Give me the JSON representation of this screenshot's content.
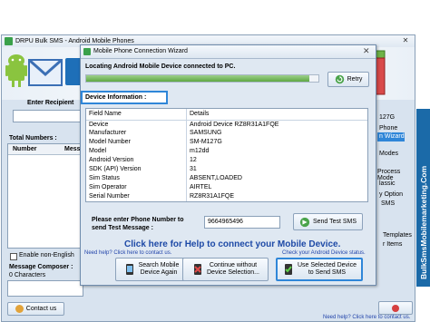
{
  "main_window": {
    "title": "DRPU Bulk SMS - Android Mobile Phones",
    "left_labels": {
      "enter_recipient": "Enter Recipient",
      "total_numbers": "Total Numbers :",
      "number_col": "Number",
      "message_col": "Mess",
      "enable_non_english": "Enable non-English",
      "message_composer": "Message Composer :",
      "char_count": "0 Characters"
    },
    "right_items": [
      "127G",
      "Phone",
      "n Wizard",
      "Modes",
      "Process Mode",
      "lassic",
      "y Option",
      "SMS",
      "Templates",
      "r Items"
    ],
    "contact_us": "Contact us",
    "need_help": "Need help? Click here to contact us.",
    "close_icon": "close-icon"
  },
  "dialog": {
    "title": "Mobile Phone Connection Wizard",
    "locating": "Locating Android Mobile Device connected to PC.",
    "progress_fraction": 0.96,
    "retry": "Retry",
    "device_info_tab": "Device Information :",
    "table": {
      "headers": [
        "Field Name",
        "Details"
      ],
      "rows": [
        [
          "Device",
          "Android Device RZ8R31A1FQE"
        ],
        [
          "Manufacturer",
          "SAMSUNG"
        ],
        [
          "Model Number",
          "SM-M127G"
        ],
        [
          "Model",
          "m12dd"
        ],
        [
          "Android Version",
          "12"
        ],
        [
          "SDK (API) Version",
          "31"
        ],
        [
          "Sim Status",
          "ABSENT,LOADED"
        ],
        [
          "Sim Operator",
          "AIRTEL"
        ],
        [
          "Serial Number",
          "RZ8R31A1FQE"
        ]
      ]
    },
    "phone_prompt_line1": "Please enter Phone Number to",
    "phone_prompt_line2": "send Test Message :",
    "phone_value": "9664965496",
    "send_test": "Send Test SMS",
    "help_link": "Click here for Help to connect your Mobile Device.",
    "need_help": "Need help? Click here to contact us.",
    "check_version": "Check your Android Device status.",
    "search_again_line1": "Search Mobile",
    "search_again_line2": "Device Again",
    "continue_line1": "Continue without",
    "continue_line2": "Device Selection...",
    "use_selected_line1": "Use Selected Device",
    "use_selected_line2": "to Send SMS"
  },
  "side_banner": "BulkSmsMobilemarketing.Com",
  "colors": {
    "accent_blue": "#2f86d8",
    "link_blue": "#1d49a6",
    "side_banner": "#1b6aa8"
  }
}
